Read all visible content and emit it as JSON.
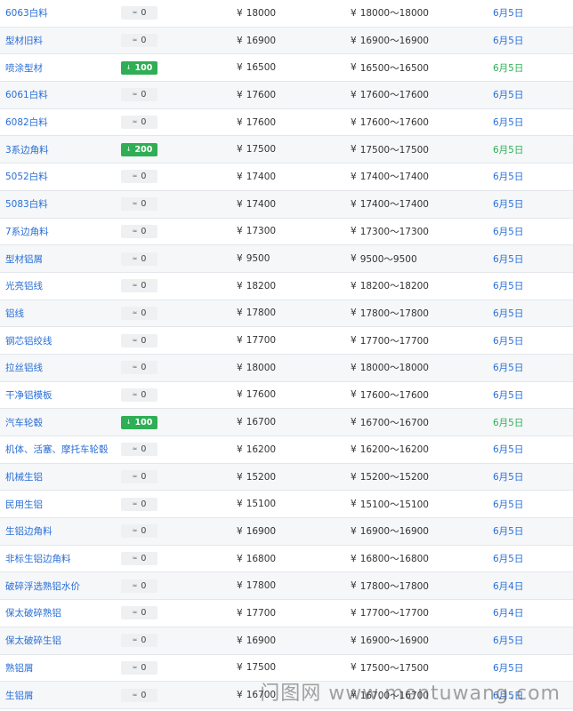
{
  "currency_symbol": "¥",
  "colors": {
    "link_blue": "#2a6fd6",
    "down_green": "#2fae55",
    "flat_badge_bg": "#eef0f2"
  },
  "rows": [
    {
      "name": "6063白料",
      "change": "0",
      "change_type": "flat",
      "price": "18000",
      "range": "18000～18000",
      "date": "6月5日",
      "date_color": "blue"
    },
    {
      "name": "型材旧料",
      "change": "0",
      "change_type": "flat",
      "price": "16900",
      "range": "16900～16900",
      "date": "6月5日",
      "date_color": "blue"
    },
    {
      "name": "喷涂型材",
      "change": "100",
      "change_type": "down",
      "price": "16500",
      "range": "16500～16500",
      "date": "6月5日",
      "date_color": "green"
    },
    {
      "name": "6061白料",
      "change": "0",
      "change_type": "flat",
      "price": "17600",
      "range": "17600～17600",
      "date": "6月5日",
      "date_color": "blue"
    },
    {
      "name": "6082白料",
      "change": "0",
      "change_type": "flat",
      "price": "17600",
      "range": "17600～17600",
      "date": "6月5日",
      "date_color": "blue"
    },
    {
      "name": "3系边角料",
      "change": "200",
      "change_type": "down",
      "price": "17500",
      "range": "17500～17500",
      "date": "6月5日",
      "date_color": "green"
    },
    {
      "name": "5052白料",
      "change": "0",
      "change_type": "flat",
      "price": "17400",
      "range": "17400～17400",
      "date": "6月5日",
      "date_color": "blue"
    },
    {
      "name": "5083白料",
      "change": "0",
      "change_type": "flat",
      "price": "17400",
      "range": "17400～17400",
      "date": "6月5日",
      "date_color": "blue"
    },
    {
      "name": "7系边角料",
      "change": "0",
      "change_type": "flat",
      "price": "17300",
      "range": "17300～17300",
      "date": "6月5日",
      "date_color": "blue"
    },
    {
      "name": "型材铝屑",
      "change": "0",
      "change_type": "flat",
      "price": "9500",
      "range": "9500～9500",
      "date": "6月5日",
      "date_color": "blue"
    },
    {
      "name": "光亮铝线",
      "change": "0",
      "change_type": "flat",
      "price": "18200",
      "range": "18200～18200",
      "date": "6月5日",
      "date_color": "blue"
    },
    {
      "name": "铝线",
      "change": "0",
      "change_type": "flat",
      "price": "17800",
      "range": "17800～17800",
      "date": "6月5日",
      "date_color": "blue"
    },
    {
      "name": "钢芯铝绞线",
      "change": "0",
      "change_type": "flat",
      "price": "17700",
      "range": "17700～17700",
      "date": "6月5日",
      "date_color": "blue"
    },
    {
      "name": "拉丝铝线",
      "change": "0",
      "change_type": "flat",
      "price": "18000",
      "range": "18000～18000",
      "date": "6月5日",
      "date_color": "blue"
    },
    {
      "name": "干净铝模板",
      "change": "0",
      "change_type": "flat",
      "price": "17600",
      "range": "17600～17600",
      "date": "6月5日",
      "date_color": "blue"
    },
    {
      "name": "汽车轮毂",
      "change": "100",
      "change_type": "down",
      "price": "16700",
      "range": "16700～16700",
      "date": "6月5日",
      "date_color": "green"
    },
    {
      "name": "机体、活塞、摩托车轮毂",
      "change": "0",
      "change_type": "flat",
      "price": "16200",
      "range": "16200～16200",
      "date": "6月5日",
      "date_color": "blue"
    },
    {
      "name": "机械生铝",
      "change": "0",
      "change_type": "flat",
      "price": "15200",
      "range": "15200～15200",
      "date": "6月5日",
      "date_color": "blue"
    },
    {
      "name": "民用生铝",
      "change": "0",
      "change_type": "flat",
      "price": "15100",
      "range": "15100～15100",
      "date": "6月5日",
      "date_color": "blue"
    },
    {
      "name": "生铝边角料",
      "change": "0",
      "change_type": "flat",
      "price": "16900",
      "range": "16900～16900",
      "date": "6月5日",
      "date_color": "blue"
    },
    {
      "name": "非标生铝边角料",
      "change": "0",
      "change_type": "flat",
      "price": "16800",
      "range": "16800～16800",
      "date": "6月5日",
      "date_color": "blue"
    },
    {
      "name": "破碎浮选熟铝水价",
      "change": "0",
      "change_type": "flat",
      "price": "17800",
      "range": "17800～17800",
      "date": "6月4日",
      "date_color": "blue"
    },
    {
      "name": "保太破碎熟铝",
      "change": "0",
      "change_type": "flat",
      "price": "17700",
      "range": "17700～17700",
      "date": "6月4日",
      "date_color": "blue"
    },
    {
      "name": "保太破碎生铝",
      "change": "0",
      "change_type": "flat",
      "price": "16900",
      "range": "16900～16900",
      "date": "6月5日",
      "date_color": "blue"
    },
    {
      "name": "熟铝屑",
      "change": "0",
      "change_type": "flat",
      "price": "17500",
      "range": "17500～17500",
      "date": "6月5日",
      "date_color": "blue"
    },
    {
      "name": "生铝屑",
      "change": "0",
      "change_type": "flat",
      "price": "16700",
      "range": "16700～16700",
      "date": "6月5日",
      "date_color": "blue"
    }
  ],
  "watermark": "门图网 www.mentuwang.com"
}
